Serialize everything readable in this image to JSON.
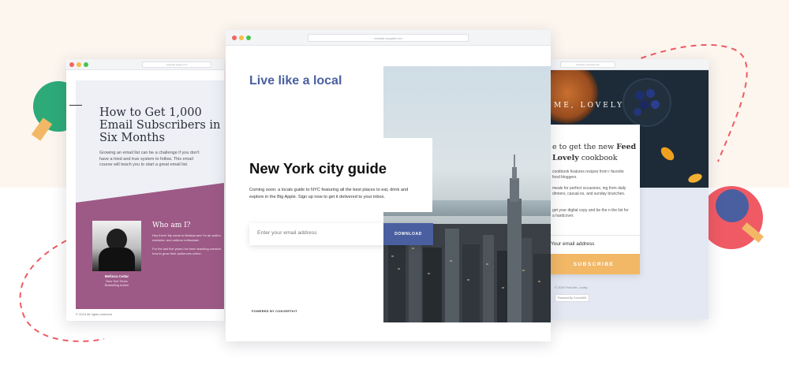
{
  "colors": {
    "accent_blue": "#4a5fa0",
    "plum": "#9d5a86",
    "gold": "#f2b866",
    "green": "#2daa78",
    "red": "#f05a64"
  },
  "left_window": {
    "url": "example.pages.com",
    "headline": "How to Get 1,000 Email Subscribers in Six Months",
    "intro": "Growing an email list can be a challenge if you don't have a tried and true system to follow. This email course will teach you to start a great email list.",
    "about_title": "Who am I?",
    "about_p1": "Hey there! My name is Melissa and I'm an author, marketer, and outdoor enthusiast.",
    "about_p2": "For the last five years I've been teaching creators how to grow their audiences online.",
    "author_name": "Melissa Cedar",
    "author_role_1": "New York Times",
    "author_role_2": "Bestselling Author",
    "footer": "© 2019 All rights reserved"
  },
  "center_window": {
    "url": "example.nycguide.com",
    "tagline": "Live like a local",
    "title": "New York city guide",
    "description": "Coming soon: a locals guide to NYC featuring all the best places to eat, drink and explore in the Big Apple. Sign up now to get it delivered to your inbox.",
    "email_placeholder": "Enter your email address",
    "download_label": "DOWNLOAD",
    "powered_by": "POWERED BY CONVERTKIT"
  },
  "right_window": {
    "url": "example.mylovely.com",
    "brand": "ME, LOVELY",
    "title_plain": "e to get the new ",
    "title_bold_1": "Feed",
    "title_bold_2": "Lovely",
    "title_plain_2": " cookbook",
    "p1": "cookbook features recipes from r favorite food bloggers.",
    "p2": "meals for perfect occasions, ing from daily dinners, casual es, and sunday brunches.",
    "p3": "get your digital copy and be the n the list for a hardcover.",
    "email_placeholder": "Your email address",
    "subscribe_label": "SUBSCRIBE",
    "footer": "© 2019 Feed Me, Lovely",
    "powered_by": "Powered By ConvertKit"
  }
}
